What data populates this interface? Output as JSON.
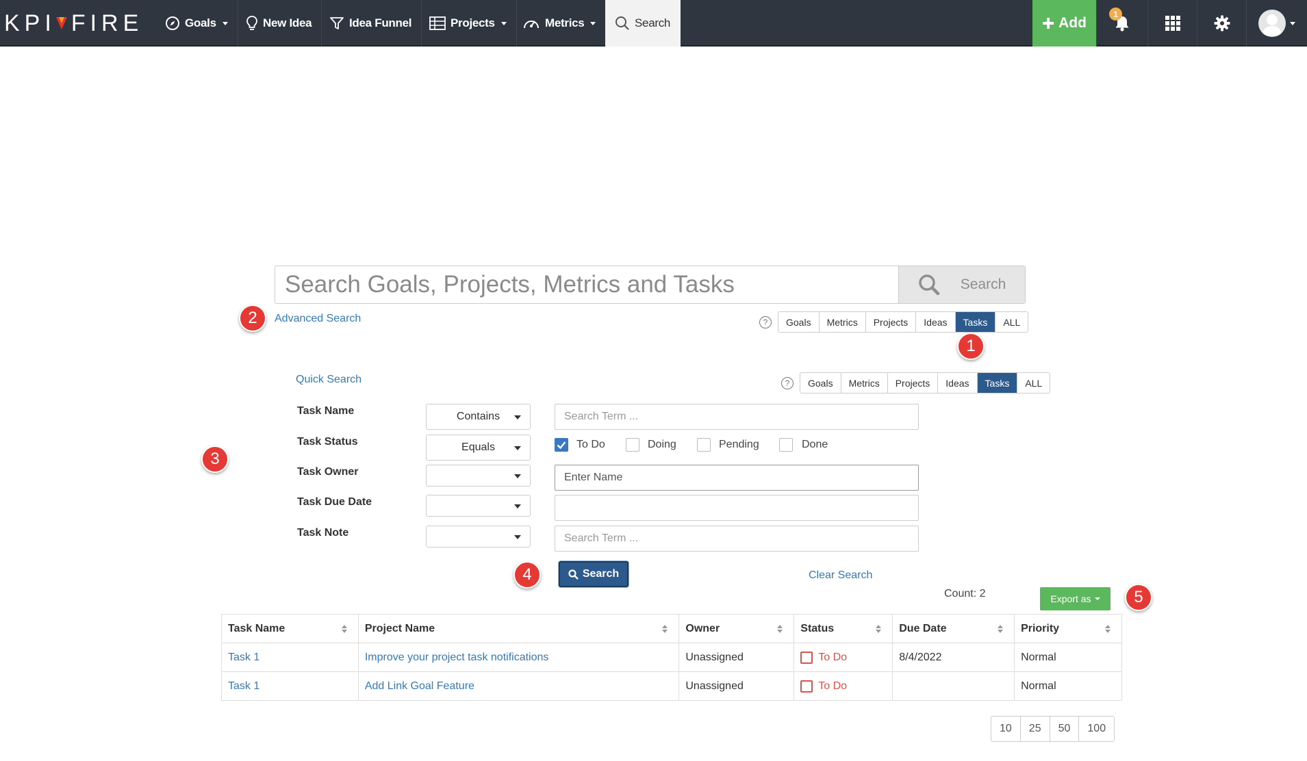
{
  "brand": {
    "left": "KPI",
    "right": "FIRE",
    "flame_color": "#e8312b"
  },
  "nav": {
    "goals": "Goals",
    "new_idea": "New Idea",
    "idea_funnel": "Idea Funnel",
    "projects": "Projects",
    "metrics": "Metrics",
    "search": "Search",
    "add": "Add",
    "notification_count": "1"
  },
  "main_search": {
    "placeholder": "Search Goals, Projects, Metrics and Tasks",
    "button": "Search"
  },
  "advanced_search_link": "Advanced Search",
  "quick_search_link": "Quick Search",
  "scope_filters": [
    "Goals",
    "Metrics",
    "Projects",
    "Ideas",
    "Tasks",
    "ALL"
  ],
  "active_scope": "Tasks",
  "help_symbol": "?",
  "markers": [
    "1",
    "2",
    "3",
    "4",
    "5"
  ],
  "form": {
    "task_name": {
      "label": "Task Name",
      "operator": "Contains",
      "placeholder": "Search Term ..."
    },
    "task_status": {
      "label": "Task Status",
      "operator": "Equals",
      "options": [
        {
          "label": "To Do",
          "checked": true
        },
        {
          "label": "Doing",
          "checked": false
        },
        {
          "label": "Pending",
          "checked": false
        },
        {
          "label": "Done",
          "checked": false
        }
      ]
    },
    "task_owner": {
      "label": "Task Owner",
      "operator": "",
      "placeholder": "Enter Name"
    },
    "task_due_date": {
      "label": "Task Due Date",
      "operator": "",
      "value": ""
    },
    "task_note": {
      "label": "Task Note",
      "operator": "",
      "placeholder": "Search Term ..."
    }
  },
  "actions": {
    "search": "Search",
    "clear": "Clear Search",
    "export": "Export as"
  },
  "count_label": "Count: 2",
  "table": {
    "headers": [
      "Task Name",
      "Project Name",
      "Owner",
      "Status",
      "Due Date",
      "Priority"
    ],
    "rows": [
      {
        "task": "Task 1",
        "project": "Improve your project task notifications",
        "owner": "Unassigned",
        "status": "To Do",
        "due": "8/4/2022",
        "priority": "Normal"
      },
      {
        "task": "Task 1",
        "project": "Add Link Goal Feature",
        "owner": "Unassigned",
        "status": "To Do",
        "due": "",
        "priority": "Normal"
      }
    ]
  },
  "page_sizes": [
    "10",
    "25",
    "50",
    "100"
  ],
  "colors": {
    "nav_bg": "#2f3640",
    "accent": "#2c5a8c",
    "add_green": "#5cb85c",
    "link": "#337ab7",
    "marker_red": "#e53935",
    "status_red": "#d9534f"
  }
}
